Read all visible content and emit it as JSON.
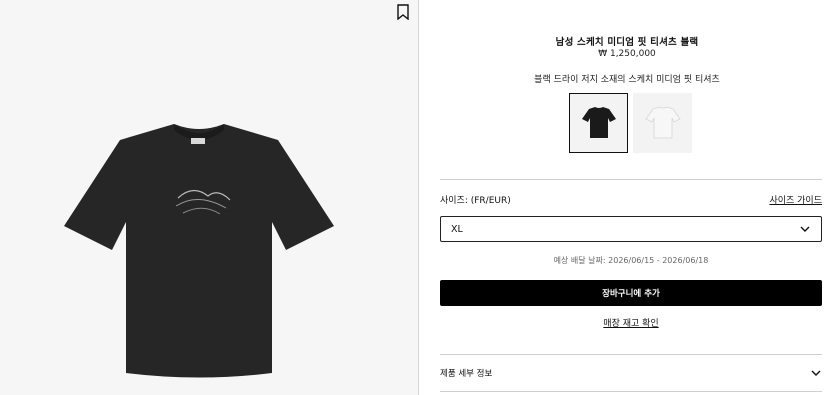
{
  "product": {
    "title": "남성 스케치 미디엄 핏 티셔츠 블랙",
    "price": "₩ 1,250,000",
    "subtitle": "블랙 드라이 저지 소재의 스케치 미디엄 핏 티셔츠"
  },
  "variants": [
    {
      "color": "#1a1a1a",
      "selected": true
    },
    {
      "color": "#f4f4f4",
      "selected": false
    }
  ],
  "size": {
    "label": "사이즈: (FR/EUR)",
    "guide_link": "사이즈 가이드",
    "selected": "XL"
  },
  "delivery": "예상 배달 날짜: 2026/06/15 - 2026/06/18",
  "actions": {
    "add_to_cart": "장바구니에 추가",
    "store_stock": "매장 재고 확인"
  },
  "details": {
    "label": "제품 세부 정보"
  },
  "icons": {
    "bookmark": "bookmark-icon",
    "chevron": "chevron-down-icon"
  }
}
